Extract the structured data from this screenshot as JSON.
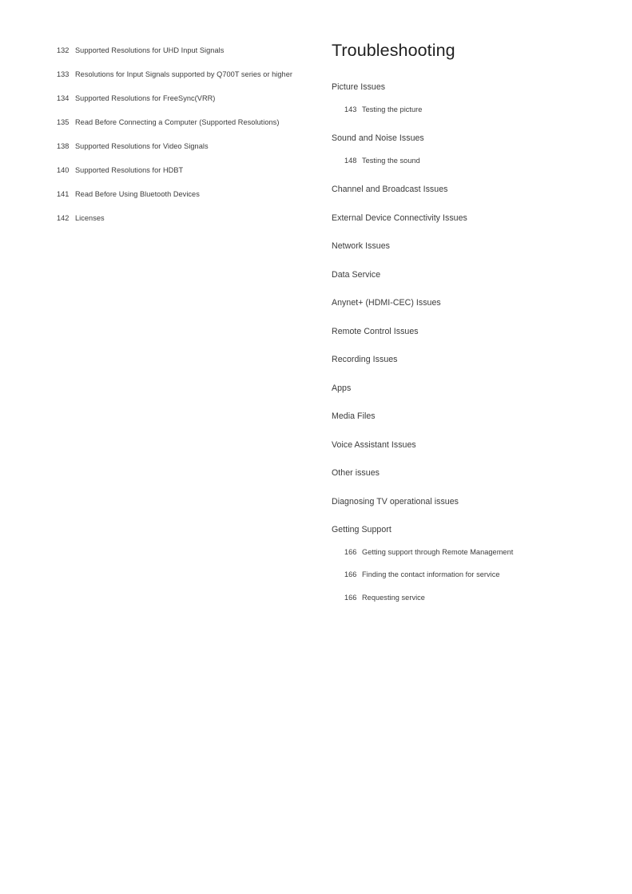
{
  "document": {
    "page_background": "#ffffff",
    "text_color": "#3b3b3b",
    "heading_color": "#222222"
  },
  "left_column": {
    "name": "table-of-contents-continued",
    "entries": [
      {
        "page": "132",
        "label": "Supported Resolutions for UHD Input Signals"
      },
      {
        "page": "133",
        "label": "Resolutions for Input Signals supported by Q700T series or higher"
      },
      {
        "page": "134",
        "label": "Supported Resolutions for FreeSync(VRR)"
      },
      {
        "page": "135",
        "label": "Read Before Connecting a Computer (Supported Resolutions)"
      },
      {
        "page": "138",
        "label": "Supported Resolutions for Video Signals"
      },
      {
        "page": "140",
        "label": "Supported Resolutions for HDBT"
      },
      {
        "page": "141",
        "label": "Read Before Using Bluetooth Devices"
      },
      {
        "page": "142",
        "label": "Licenses"
      }
    ]
  },
  "right_column": {
    "chapter_title": "Troubleshooting",
    "sections": [
      {
        "title": "Picture Issues",
        "entries": [
          {
            "page": "143",
            "label": "Testing the picture"
          }
        ]
      },
      {
        "title": "Sound and Noise Issues",
        "entries": [
          {
            "page": "148",
            "label": "Testing the sound"
          }
        ]
      },
      {
        "title": "Channel and Broadcast Issues",
        "entries": []
      },
      {
        "title": "External Device Connectivity Issues",
        "entries": []
      },
      {
        "title": "Network Issues",
        "entries": []
      },
      {
        "title": "Data Service",
        "entries": []
      },
      {
        "title": "Anynet+ (HDMI-CEC) Issues",
        "entries": []
      },
      {
        "title": "Remote Control Issues",
        "entries": []
      },
      {
        "title": "Recording Issues",
        "entries": []
      },
      {
        "title": "Apps",
        "entries": []
      },
      {
        "title": "Media Files",
        "entries": []
      },
      {
        "title": "Voice Assistant Issues",
        "entries": []
      },
      {
        "title": "Other issues",
        "entries": []
      },
      {
        "title": "Diagnosing TV operational issues",
        "entries": []
      },
      {
        "title": "Getting Support",
        "entries": [
          {
            "page": "166",
            "label": "Getting support through Remote Management"
          },
          {
            "page": "166",
            "label": "Finding the contact information for service"
          },
          {
            "page": "166",
            "label": "Requesting service"
          }
        ]
      }
    ]
  }
}
